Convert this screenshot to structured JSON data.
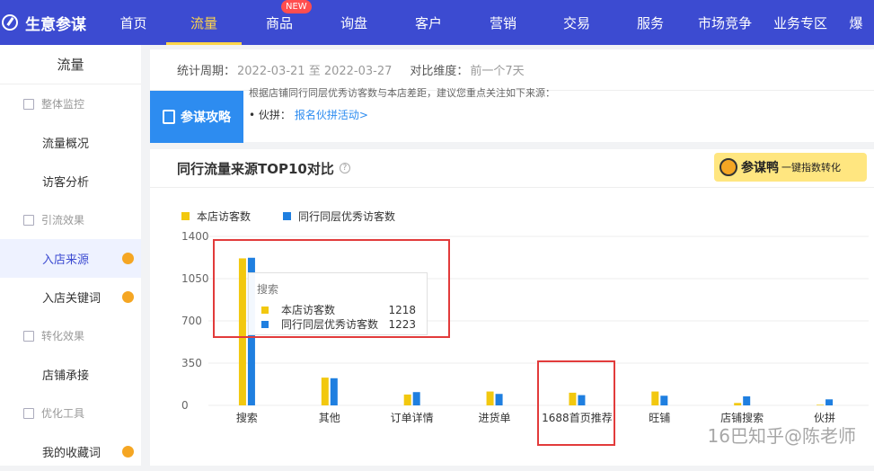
{
  "brand": {
    "name": "生意参谋"
  },
  "nav": {
    "items": [
      "首页",
      "流量",
      "商品",
      "询盘",
      "客户",
      "营销",
      "交易",
      "服务",
      "市场竞争",
      "业务专区",
      "爆"
    ],
    "active_index": 1,
    "new_badge": "NEW"
  },
  "sidebar": {
    "title": "流量",
    "entries": [
      {
        "kind": "group",
        "label": "整体监控"
      },
      {
        "kind": "item",
        "label": "流量概况"
      },
      {
        "kind": "item",
        "label": "访客分析"
      },
      {
        "kind": "group",
        "label": "引流效果"
      },
      {
        "kind": "item",
        "label": "入店来源",
        "active": true,
        "dot": true
      },
      {
        "kind": "item",
        "label": "入店关键词",
        "dot": true
      },
      {
        "kind": "group",
        "label": "转化效果"
      },
      {
        "kind": "item",
        "label": "店铺承接"
      },
      {
        "kind": "group",
        "label": "优化工具"
      },
      {
        "kind": "item",
        "label": "我的收藏词",
        "dot": true
      }
    ]
  },
  "period": {
    "label": "统计周期：",
    "value": "2022-03-21 至 2022-03-27",
    "compare_label": "对比维度：",
    "compare_value": "前一个7天"
  },
  "tips": {
    "label": "参谋攻略",
    "line1": "根据店铺同行同层优秀访客数与本店差距，建议您重点关注如下来源：",
    "line2_prefix": "• 伙拼：",
    "line2_link": "报名伙拼活动>"
  },
  "panel": {
    "title": "同行流量来源TOP10对比",
    "help": "?",
    "plugin_name": "参谋鸭",
    "plugin_sub": "一键指数转化"
  },
  "colors": {
    "own": "#f2c80f",
    "peer": "#1f7fe0",
    "accent": "#3c4bd1",
    "highlight": "#e23b3b"
  },
  "chart_data": {
    "type": "bar",
    "categories": [
      "搜索",
      "其他",
      "订单详情",
      "进货单",
      "1688首页推荐",
      "旺铺",
      "店铺搜索",
      "伙拼"
    ],
    "series": [
      {
        "name": "本店访客数",
        "values": [
          1218,
          230,
          90,
          115,
          105,
          115,
          20,
          5
        ]
      },
      {
        "name": "同行同层优秀访客数",
        "values": [
          1223,
          225,
          110,
          95,
          85,
          80,
          75,
          50
        ]
      }
    ],
    "yticks": [
      0,
      350,
      700,
      1050,
      1400
    ],
    "ylim": [
      0,
      1400
    ],
    "legend": "top-left",
    "tooltip": {
      "title": "搜索",
      "rows": [
        {
          "name": "本店访客数",
          "value": "1218"
        },
        {
          "name": "同行同层优秀访客数",
          "value": "1223"
        }
      ]
    }
  },
  "watermark": "16巴知乎@陈老师"
}
